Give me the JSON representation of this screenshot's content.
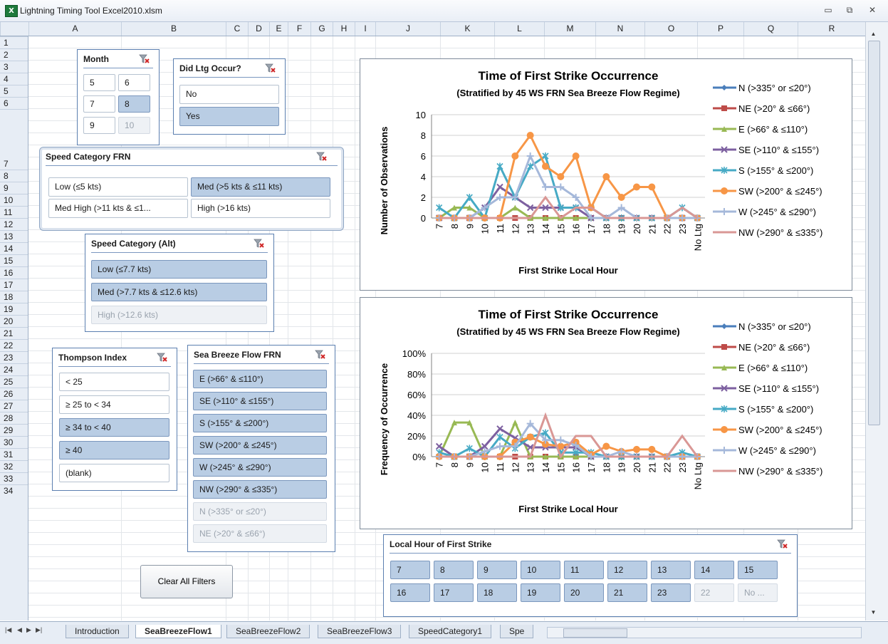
{
  "window": {
    "title": "Lightning Timing Tool Excel2010.xlsm",
    "app_icon_text": "X"
  },
  "columns": [
    "A",
    "B",
    "C",
    "D",
    "E",
    "F",
    "G",
    "H",
    "I",
    "J",
    "K",
    "L",
    "M",
    "N",
    "O",
    "P",
    "Q",
    "R"
  ],
  "rows": [
    "1",
    "2",
    "3",
    "4",
    "5",
    "6",
    "7",
    "8",
    "9",
    "10",
    "11",
    "12",
    "13",
    "14",
    "15",
    "16",
    "17",
    "18",
    "19",
    "20",
    "21",
    "22",
    "23",
    "24",
    "25",
    "26",
    "27",
    "28",
    "29",
    "30",
    "31",
    "32",
    "33",
    "34"
  ],
  "slicers": {
    "month": {
      "title": "Month",
      "items": [
        {
          "label": "5",
          "state": "normal"
        },
        {
          "label": "6",
          "state": "normal"
        },
        {
          "label": "7",
          "state": "normal"
        },
        {
          "label": "8",
          "state": "selected"
        },
        {
          "label": "9",
          "state": "normal"
        },
        {
          "label": "10",
          "state": "disabled"
        }
      ]
    },
    "did_ltg": {
      "title": "Did Ltg Occur?",
      "items": [
        {
          "label": "No",
          "state": "normal"
        },
        {
          "label": "Yes",
          "state": "selected"
        }
      ]
    },
    "speed_frn": {
      "title": "Speed Category FRN",
      "items": [
        {
          "label": "Low (≤5 kts)",
          "state": "normal"
        },
        {
          "label": "Med (>5 kts & ≤11 kts)",
          "state": "selected"
        },
        {
          "label": "Med High (>11 kts & ≤1...",
          "state": "normal"
        },
        {
          "label": "High (>16 kts)",
          "state": "normal"
        }
      ]
    },
    "speed_alt": {
      "title": "Speed Category (Alt)",
      "items": [
        {
          "label": "Low (≤7.7 kts)",
          "state": "selected"
        },
        {
          "label": "Med (>7.7 kts & ≤12.6 kts)",
          "state": "selected"
        },
        {
          "label": "High (>12.6 kts)",
          "state": "disabled"
        }
      ]
    },
    "thompson": {
      "title": "Thompson Index",
      "items": [
        {
          "label": "< 25",
          "state": "normal"
        },
        {
          "label": "≥ 25 to < 34",
          "state": "normal"
        },
        {
          "label": "≥ 34  to < 40",
          "state": "selected"
        },
        {
          "label": "≥ 40",
          "state": "selected"
        },
        {
          "label": "(blank)",
          "state": "normal"
        }
      ]
    },
    "seabreeze": {
      "title": "Sea Breeze Flow FRN",
      "items": [
        {
          "label": "E (>66° & ≤110°)",
          "state": "selected"
        },
        {
          "label": "SE (>110° & ≤155°)",
          "state": "selected"
        },
        {
          "label": "S (>155° & ≤200°)",
          "state": "selected"
        },
        {
          "label": "SW (>200° & ≤245°)",
          "state": "selected"
        },
        {
          "label": "W (>245° & ≤290°)",
          "state": "selected"
        },
        {
          "label": "NW (>290° & ≤335°)",
          "state": "selected"
        },
        {
          "label": "N (>335° or ≤20°)",
          "state": "disabled"
        },
        {
          "label": "NE (>20° & ≤66°)",
          "state": "disabled"
        }
      ]
    },
    "local_hour": {
      "title": "Local Hour of First Strike",
      "items": [
        {
          "label": "7",
          "state": "selected"
        },
        {
          "label": "8",
          "state": "selected"
        },
        {
          "label": "9",
          "state": "selected"
        },
        {
          "label": "10",
          "state": "selected"
        },
        {
          "label": "11",
          "state": "selected"
        },
        {
          "label": "12",
          "state": "selected"
        },
        {
          "label": "13",
          "state": "selected"
        },
        {
          "label": "14",
          "state": "selected"
        },
        {
          "label": "15",
          "state": "selected"
        },
        {
          "label": "16",
          "state": "selected"
        },
        {
          "label": "17",
          "state": "selected"
        },
        {
          "label": "18",
          "state": "selected"
        },
        {
          "label": "19",
          "state": "selected"
        },
        {
          "label": "20",
          "state": "selected"
        },
        {
          "label": "21",
          "state": "selected"
        },
        {
          "label": "23",
          "state": "selected"
        },
        {
          "label": "22",
          "state": "disabled"
        },
        {
          "label": "No ...",
          "state": "disabled"
        }
      ]
    }
  },
  "clear_button": "Clear All Filters",
  "sheet_tabs": [
    "Introduction",
    "SeaBreezeFlow1",
    "SeaBreezeFlow2",
    "SeaBreezeFlow3",
    "SpeedCategory1",
    "Spe"
  ],
  "active_tab": "SeaBreezeFlow1",
  "chart_data": [
    {
      "type": "line",
      "title": "Time of First Strike Occurrence",
      "subtitle": "(Stratified by 45 WS FRN Sea Breeze Flow Regime)",
      "xlabel": "First Strike Local Hour",
      "ylabel": "Number of Observations",
      "ylim": [
        0,
        10
      ],
      "yticks": [
        "0",
        "2",
        "4",
        "6",
        "8",
        "10"
      ],
      "legend": "right",
      "categories": [
        "7",
        "8",
        "9",
        "10",
        "11",
        "12",
        "13",
        "14",
        "15",
        "16",
        "17",
        "18",
        "19",
        "20",
        "21",
        "22",
        "23",
        "No Ltg"
      ],
      "series": [
        {
          "name": "N (>335° or ≤20°)",
          "color": "#4a7ebb",
          "marker": "diamond",
          "values": [
            0,
            0,
            0,
            0,
            0,
            0,
            0,
            0,
            0,
            0,
            0,
            0,
            0,
            0,
            0,
            0,
            0,
            0
          ]
        },
        {
          "name": "NE (>20° & ≤66°)",
          "color": "#be4b48",
          "marker": "square",
          "values": [
            0,
            0,
            0,
            0,
            0,
            0,
            0,
            0,
            0,
            0,
            0,
            0,
            0,
            0,
            0,
            0,
            0,
            0
          ]
        },
        {
          "name": "E (>66° & ≤110°)",
          "color": "#98b954",
          "marker": "triangle",
          "values": [
            0,
            1,
            1,
            0,
            0,
            1,
            0,
            0,
            0,
            0,
            0,
            0,
            0,
            0,
            0,
            0,
            0,
            0
          ]
        },
        {
          "name": "SE (>110° & ≤155°)",
          "color": "#7d60a0",
          "marker": "x",
          "values": [
            0,
            0,
            0,
            1,
            3,
            2,
            1,
            1,
            1,
            1,
            0,
            0,
            0,
            0,
            0,
            0,
            0,
            0
          ]
        },
        {
          "name": "S (>155° & ≤200°)",
          "color": "#46aac5",
          "marker": "star",
          "values": [
            1,
            0,
            2,
            0,
            5,
            2,
            5,
            6,
            1,
            1,
            1,
            0,
            0,
            0,
            0,
            0,
            1,
            0
          ]
        },
        {
          "name": "SW (>200° & ≤245°)",
          "color": "#f79646",
          "marker": "circle",
          "values": [
            0,
            0,
            0,
            0,
            0,
            6,
            8,
            5,
            4,
            6,
            1,
            4,
            2,
            3,
            3,
            0,
            0,
            0
          ]
        },
        {
          "name": "W (>245° & ≤290°)",
          "color": "#a5b8da",
          "marker": "plus",
          "values": [
            0,
            0,
            0,
            1,
            2,
            2,
            6,
            3,
            3,
            2,
            0,
            0,
            1,
            0,
            0,
            0,
            0,
            0
          ]
        },
        {
          "name": "NW (>290° & ≤335°)",
          "color": "#d99795",
          "marker": "none",
          "values": [
            0,
            0,
            0,
            0,
            0,
            0,
            0,
            2,
            0,
            1,
            1,
            0,
            0,
            0,
            0,
            0,
            1,
            0
          ]
        }
      ]
    },
    {
      "type": "line",
      "title": "Time of First Strike Occurrence",
      "subtitle": "(Stratified by 45 WS FRN Sea Breeze Flow Regime)",
      "xlabel": "First Strike Local Hour",
      "ylabel": "Frequency of Occurrence",
      "ylim": [
        0,
        100
      ],
      "yticks": [
        "0%",
        "20%",
        "40%",
        "60%",
        "80%",
        "100%"
      ],
      "legend": "right",
      "categories": [
        "7",
        "8",
        "9",
        "10",
        "11",
        "12",
        "13",
        "14",
        "15",
        "16",
        "17",
        "18",
        "19",
        "20",
        "21",
        "22",
        "23",
        "No Ltg"
      ],
      "series": [
        {
          "name": "N (>335° or ≤20°)",
          "color": "#4a7ebb",
          "marker": "diamond",
          "values": [
            0,
            0,
            0,
            0,
            0,
            0,
            0,
            0,
            0,
            0,
            0,
            0,
            0,
            0,
            0,
            0,
            0,
            0
          ]
        },
        {
          "name": "NE (>20° & ≤66°)",
          "color": "#be4b48",
          "marker": "square",
          "values": [
            0,
            0,
            0,
            0,
            0,
            0,
            0,
            0,
            0,
            0,
            0,
            0,
            0,
            0,
            0,
            0,
            0,
            0
          ]
        },
        {
          "name": "E (>66° & ≤110°)",
          "color": "#98b954",
          "marker": "triangle",
          "values": [
            0,
            33,
            33,
            0,
            0,
            33,
            0,
            0,
            0,
            0,
            0,
            0,
            0,
            0,
            0,
            0,
            0,
            0
          ]
        },
        {
          "name": "SE (>110° & ≤155°)",
          "color": "#7d60a0",
          "marker": "x",
          "values": [
            10,
            0,
            0,
            10,
            27,
            18,
            9,
            9,
            9,
            9,
            0,
            0,
            0,
            0,
            0,
            0,
            0,
            0
          ]
        },
        {
          "name": "S (>155° & ≤200°)",
          "color": "#46aac5",
          "marker": "star",
          "values": [
            4,
            0,
            8,
            0,
            19,
            8,
            19,
            23,
            4,
            4,
            4,
            0,
            0,
            0,
            0,
            0,
            4,
            0
          ]
        },
        {
          "name": "SW (>200° & ≤245°)",
          "color": "#f79646",
          "marker": "circle",
          "values": [
            0,
            0,
            0,
            0,
            0,
            14,
            19,
            12,
            10,
            14,
            2,
            10,
            5,
            7,
            7,
            0,
            0,
            0
          ]
        },
        {
          "name": "W (>245° & ≤290°)",
          "color": "#a5b8da",
          "marker": "plus",
          "values": [
            0,
            0,
            0,
            5,
            10,
            10,
            32,
            16,
            16,
            11,
            0,
            0,
            5,
            0,
            0,
            0,
            0,
            0
          ]
        },
        {
          "name": "NW (>290° & ≤335°)",
          "color": "#d99795",
          "marker": "none",
          "values": [
            0,
            0,
            0,
            0,
            0,
            0,
            0,
            40,
            0,
            20,
            20,
            0,
            0,
            0,
            0,
            0,
            20,
            0
          ]
        }
      ]
    }
  ]
}
